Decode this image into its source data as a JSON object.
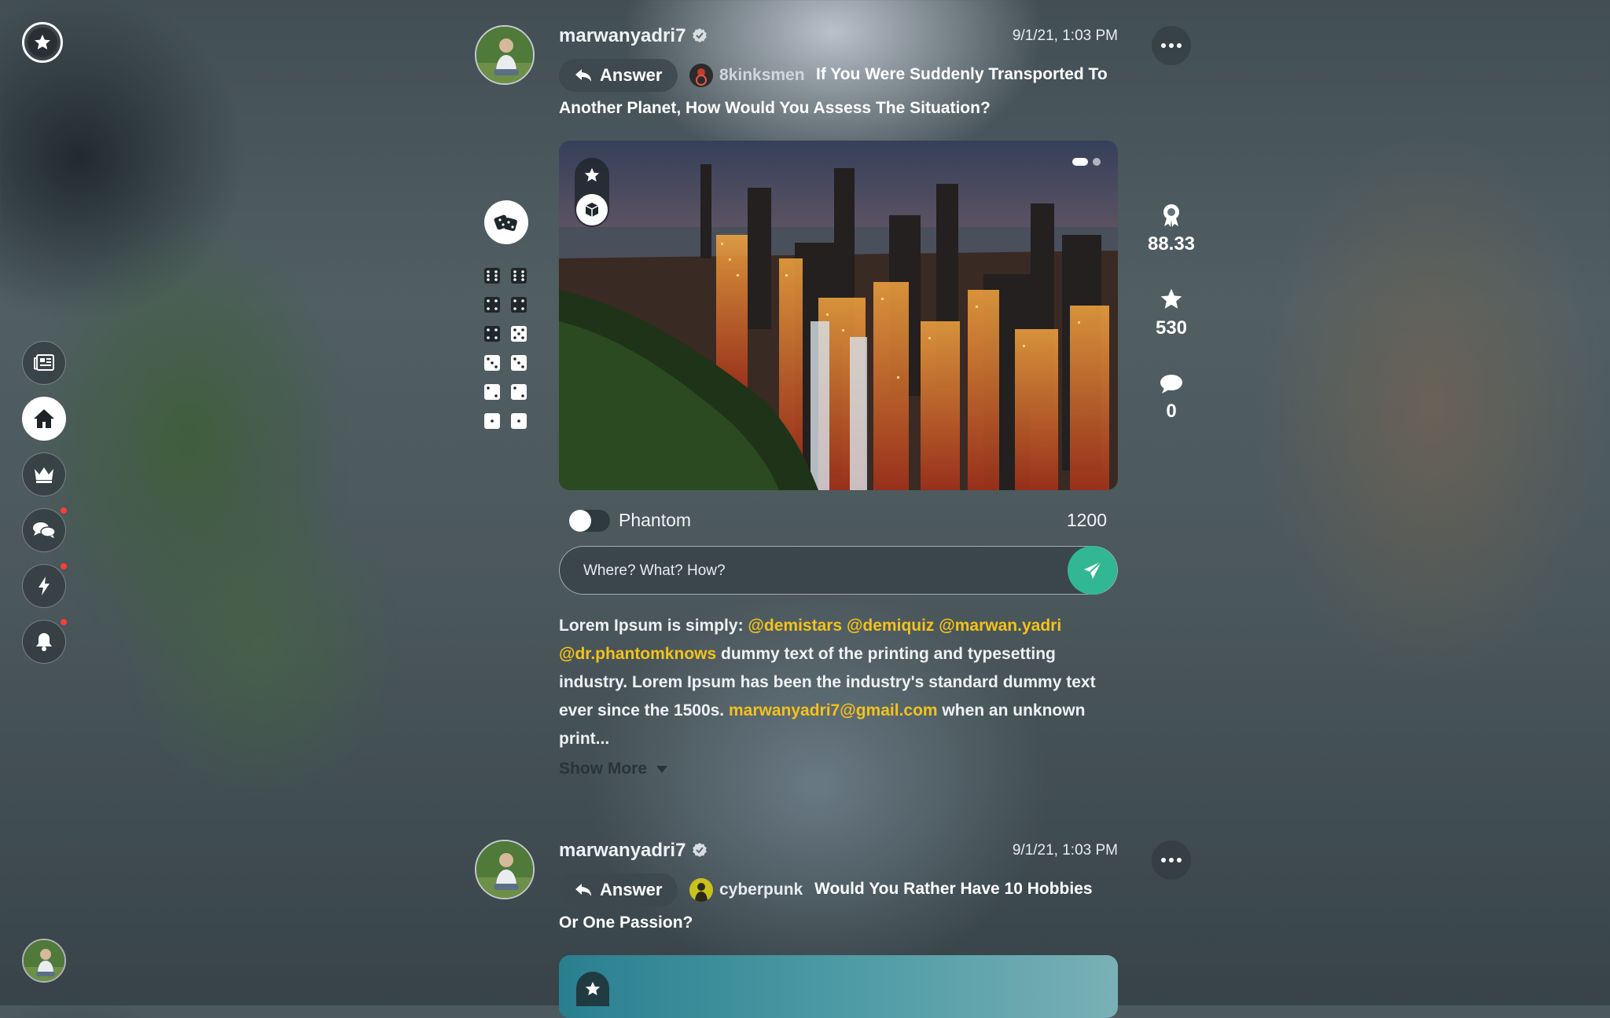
{
  "nav": {
    "logo_icon": "star-badge-icon",
    "items": [
      {
        "name": "news",
        "icon": "newspaper-icon",
        "active": false,
        "notify": false
      },
      {
        "name": "home",
        "icon": "home-icon",
        "active": true,
        "notify": false
      },
      {
        "name": "leaderboard",
        "icon": "crown-icon",
        "active": false,
        "notify": false
      },
      {
        "name": "chat",
        "icon": "chat-bubbles-icon",
        "active": false,
        "notify": true
      },
      {
        "name": "activity",
        "icon": "lightning-icon",
        "active": false,
        "notify": true
      },
      {
        "name": "notifications",
        "icon": "bell-icon",
        "active": false,
        "notify": true
      }
    ]
  },
  "side_tools": {
    "dice_button_icon": "dice-icon",
    "dice_faces": [
      6,
      6,
      4,
      4,
      4,
      5,
      3,
      3,
      2,
      2,
      1,
      1
    ]
  },
  "stats": {
    "score": "88.33",
    "stars": "530",
    "comments": "0"
  },
  "posts": [
    {
      "username": "marwanyadri7",
      "timestamp": "9/1/21, 1:03 PM",
      "answer_label": "Answer",
      "asker": "8kinksmen",
      "question": "If You Were Suddenly Transported To Another Planet, How Would You Assess The Situation?",
      "toggle_label": "Phantom",
      "count": "1200",
      "comment_placeholder": "Where? What? How?",
      "body": {
        "intro": "Lorem Ipsum is simply:",
        "mentions": [
          "@demistars",
          "@demiquiz",
          "@marwan.yadri",
          "@dr.phantomknows"
        ],
        "text1": "dummy text of the printing and typesetting industry. Lorem Ipsum has been the industry's standard dummy text ever since the 1500s.",
        "email": "marwanyadri7@gmail.com",
        "text2": "when an unknown print..."
      },
      "show_more_label": "Show More"
    },
    {
      "username": "marwanyadri7",
      "timestamp": "9/1/21, 1:03 PM",
      "answer_label": "Answer",
      "asker": "cyberpunk",
      "question": "Would You Rather Have 10 Hobbies Or One Passion?"
    }
  ],
  "colors": {
    "accent_send": "#31b892",
    "mention": "#f4c21b",
    "notify_dot": "#ff3b3b"
  }
}
